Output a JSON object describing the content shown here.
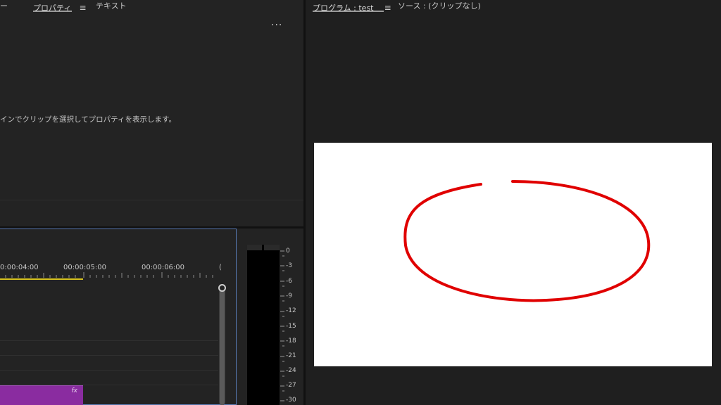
{
  "properties_panel": {
    "tabs": [
      {
        "label": "プロパティ",
        "menu": "≡",
        "active": true
      },
      {
        "label": "テキスト",
        "active": false
      }
    ],
    "partial_tab_left": "ー",
    "more_label": "···",
    "hint": "インでクリップを選択してプロパティを表示します。"
  },
  "program_panel": {
    "tabs": [
      {
        "label": "プログラム : test",
        "menu": "≡",
        "active": true
      },
      {
        "label": "ソース : (クリップなし)",
        "active": false
      }
    ],
    "frame_background": "#ffffff",
    "drawing_color": "#e00000"
  },
  "timeline": {
    "timecodes": [
      "0:00:04:00",
      "00:00:05:00",
      "00:00:06:00",
      "("
    ],
    "clip_badge": "fx",
    "clip_color": "#8a2ca0",
    "workarea_color": "#d6c21e"
  },
  "audio_meter": {
    "scale": [
      "0",
      "-3",
      "-6",
      "-9",
      "-12",
      "-15",
      "-18",
      "-21",
      "-24",
      "-27",
      "-30"
    ]
  }
}
